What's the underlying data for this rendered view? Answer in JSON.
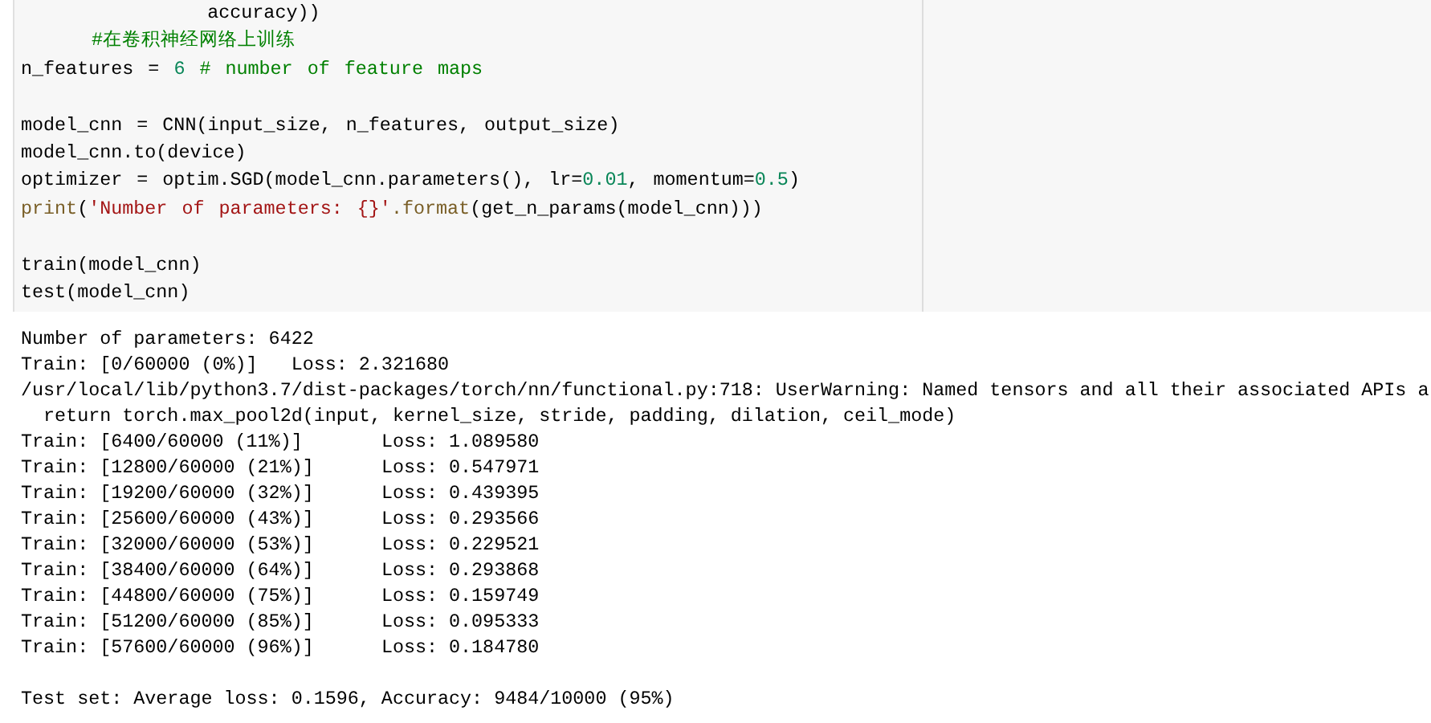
{
  "code_cell": {
    "lines": [
      {
        "kind": "code",
        "indented": true,
        "tokens": [
          {
            "kind": "plain",
            "text": "        accuracy))"
          }
        ]
      },
      {
        "kind": "code",
        "indented": true,
        "tokens": [
          {
            "kind": "comment",
            "text": "#在卷积神经网络上训练"
          }
        ]
      },
      {
        "kind": "code",
        "indented": false,
        "tokens": [
          {
            "kind": "plain",
            "text": "n_features = "
          },
          {
            "kind": "number",
            "text": "6"
          },
          {
            "kind": "comment",
            "text": " # number of feature maps"
          }
        ]
      },
      {
        "kind": "blank"
      },
      {
        "kind": "code",
        "indented": false,
        "tokens": [
          {
            "kind": "plain",
            "text": "model_cnn = CNN(input_size, n_features, output_size)"
          }
        ]
      },
      {
        "kind": "code",
        "indented": false,
        "tokens": [
          {
            "kind": "plain",
            "text": "model_cnn.to(device)"
          }
        ]
      },
      {
        "kind": "code",
        "indented": false,
        "tokens": [
          {
            "kind": "plain",
            "text": "optimizer = optim.SGD(model_cnn.parameters(), lr="
          },
          {
            "kind": "number",
            "text": "0.01"
          },
          {
            "kind": "plain",
            "text": ", momentum="
          },
          {
            "kind": "number",
            "text": "0.5"
          },
          {
            "kind": "plain",
            "text": ")"
          }
        ]
      },
      {
        "kind": "code",
        "indented": false,
        "tokens": [
          {
            "kind": "builtin",
            "text": "print"
          },
          {
            "kind": "plain",
            "text": "("
          },
          {
            "kind": "string",
            "text": "'Number of parameters: {}'"
          },
          {
            "kind": "builtin",
            "text": ".format"
          },
          {
            "kind": "plain",
            "text": "(get_n_params(model_cnn)))"
          }
        ]
      },
      {
        "kind": "blank"
      },
      {
        "kind": "code",
        "indented": false,
        "tokens": [
          {
            "kind": "plain",
            "text": "train(model_cnn)"
          }
        ]
      },
      {
        "kind": "code",
        "indented": false,
        "tokens": [
          {
            "kind": "plain",
            "text": "test(model_cnn)"
          }
        ]
      }
    ]
  },
  "output": {
    "lines": [
      {
        "kind": "text",
        "text": "Number of parameters: 6422"
      },
      {
        "kind": "text",
        "text": "Train: [0/60000 (0%)]\tLoss: 2.321680"
      },
      {
        "kind": "text",
        "text": "/usr/local/lib/python3.7/dist-packages/torch/nn/functional.py:718: UserWarning: Named tensors and all their associated APIs a"
      },
      {
        "kind": "text",
        "text": "  return torch.max_pool2d(input, kernel_size, stride, padding, dilation, ceil_mode)"
      },
      {
        "kind": "text",
        "text": "Train: [6400/60000 (11%)]\tLoss: 1.089580"
      },
      {
        "kind": "text",
        "text": "Train: [12800/60000 (21%)]\tLoss: 0.547971"
      },
      {
        "kind": "text",
        "text": "Train: [19200/60000 (32%)]\tLoss: 0.439395"
      },
      {
        "kind": "text",
        "text": "Train: [25600/60000 (43%)]\tLoss: 0.293566"
      },
      {
        "kind": "text",
        "text": "Train: [32000/60000 (53%)]\tLoss: 0.229521"
      },
      {
        "kind": "text",
        "text": "Train: [38400/60000 (64%)]\tLoss: 0.293868"
      },
      {
        "kind": "text",
        "text": "Train: [44800/60000 (75%)]\tLoss: 0.159749"
      },
      {
        "kind": "text",
        "text": "Train: [51200/60000 (85%)]\tLoss: 0.095333"
      },
      {
        "kind": "text",
        "text": "Train: [57600/60000 (96%)]\tLoss: 0.184780"
      },
      {
        "kind": "blank"
      },
      {
        "kind": "text",
        "text": "Test set: Average loss: 0.1596, Accuracy: 9484/10000 (95%)"
      }
    ]
  }
}
